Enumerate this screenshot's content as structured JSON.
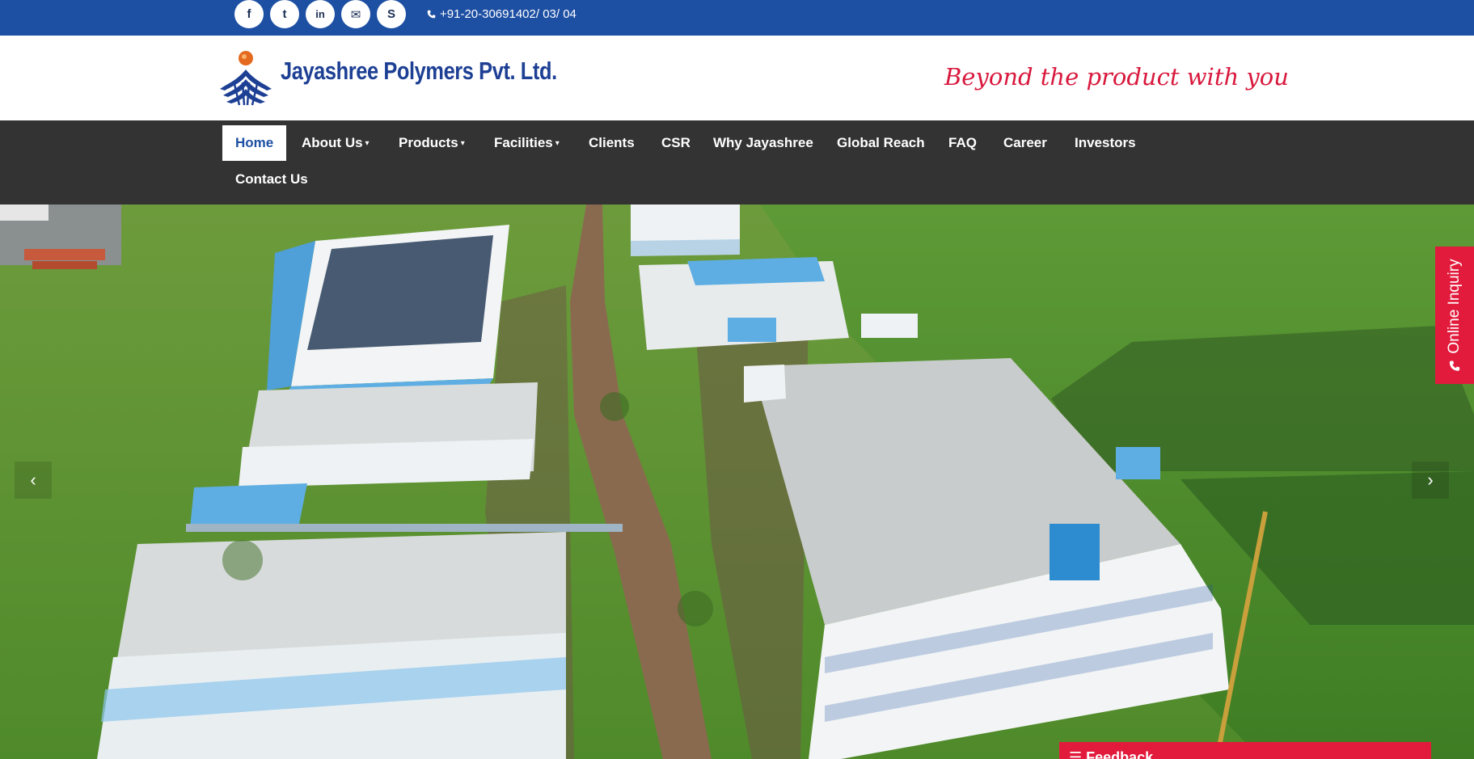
{
  "topbar": {
    "social": [
      {
        "icon": "facebook-icon",
        "glyph": "f"
      },
      {
        "icon": "twitter-icon",
        "glyph": "t"
      },
      {
        "icon": "linkedin-icon",
        "glyph": "in"
      },
      {
        "icon": "envelope-icon",
        "glyph": "✉"
      },
      {
        "icon": "skype-icon",
        "glyph": "S"
      }
    ],
    "phone": "+91-20-30691402/ 03/ 04"
  },
  "header": {
    "company_name": "Jayashree Polymers Pvt. Ltd.",
    "tagline": "Beyond the product with you"
  },
  "nav": {
    "items": [
      {
        "label": "Home",
        "active": true,
        "dropdown": false
      },
      {
        "label": "About Us",
        "dropdown": true
      },
      {
        "label": "Products",
        "dropdown": true
      },
      {
        "label": "Facilities",
        "dropdown": true
      },
      {
        "label": "Clients",
        "dropdown": false
      },
      {
        "label": "CSR",
        "dropdown": false
      },
      {
        "label": "Why Jayashree",
        "dropdown": false
      },
      {
        "label": "Global Reach",
        "dropdown": false
      },
      {
        "label": "FAQ",
        "dropdown": false
      },
      {
        "label": "Career",
        "dropdown": false
      },
      {
        "label": "Investors",
        "dropdown": false
      },
      {
        "label": "Contact Us",
        "dropdown": false
      }
    ]
  },
  "inquiry": {
    "label": "Online Inquiry"
  },
  "feedback": {
    "label": "Feedback"
  },
  "colors": {
    "brand_blue": "#1d4fa3",
    "nav_bg": "#333333",
    "accent_red": "#e21b3c"
  }
}
